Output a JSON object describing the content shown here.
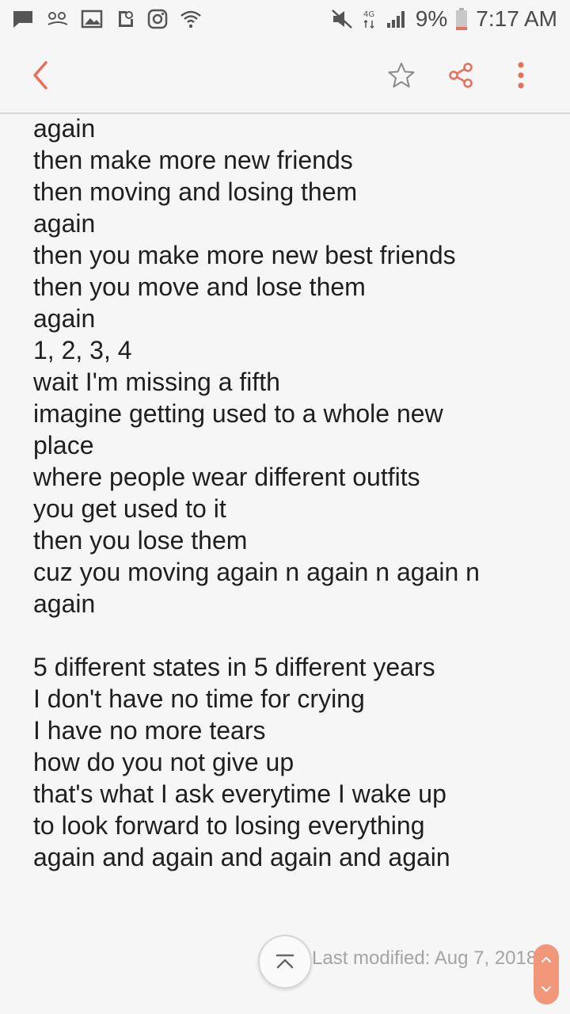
{
  "status_bar": {
    "battery_percent": "9%",
    "time": "7:17 AM",
    "network_label": "4G",
    "icons": [
      "message-icon",
      "eye-icon",
      "gallery-icon",
      "screenshot-icon",
      "instagram-icon",
      "wifi-icon",
      "mute-icon",
      "signal-icon",
      "battery-icon"
    ]
  },
  "toolbar": {
    "back_icon": "chevron-left-icon",
    "star_icon": "star-outline-icon",
    "share_icon": "share-icon",
    "more_icon": "more-vertical-icon",
    "accent_color": "#e8705a"
  },
  "note": {
    "lines": [
      "again",
      "then make more new friends",
      "then moving and losing them",
      "again",
      "then you make more new best friends",
      "then you move and lose them",
      "again",
      "1, 2, 3, 4",
      "wait I'm missing a fifth",
      "imagine getting used to a whole new",
      "place",
      "where people wear different outfits",
      "you get used to it",
      "then you lose them",
      "cuz you moving again n again n again n",
      "again",
      "",
      "5 different states in 5 different years",
      "I don't have no time for crying",
      "I have no more tears",
      "how do you not give up",
      "that's what I ask everytime I wake up",
      "to look forward to losing everything",
      "again and again and again and again"
    ]
  },
  "footer": {
    "last_modified": "Last modified: Aug 7, 2018",
    "scroll_top_icon": "scroll-to-top-icon",
    "scroll_handle_color": "#f1977a"
  }
}
